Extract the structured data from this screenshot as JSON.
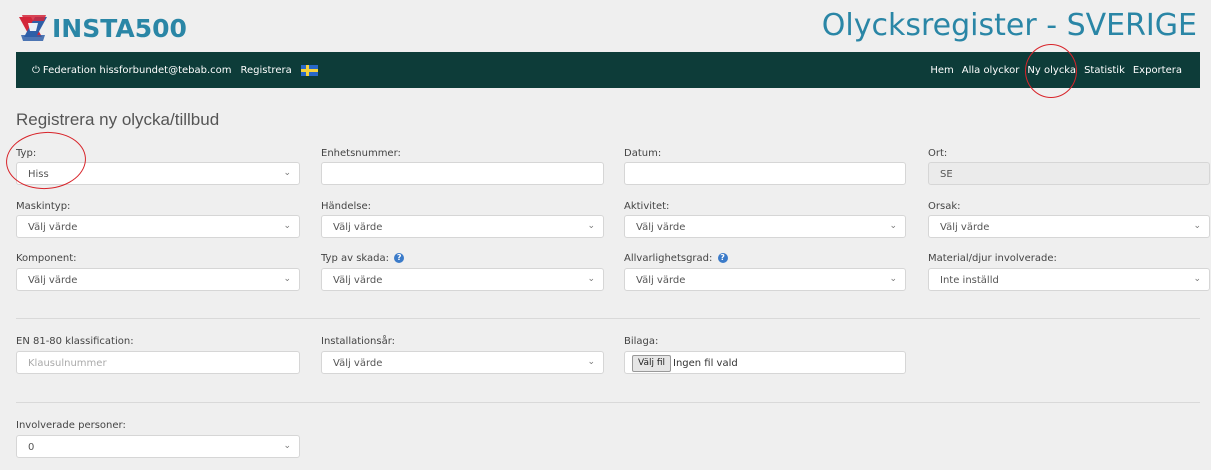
{
  "brand": {
    "logo_text": "INSTA500"
  },
  "app_title": "Olycksregister - SVERIGE",
  "nav": {
    "user": "Federation hissforbundet@tebab.com",
    "register_link": "Registrera",
    "links": [
      "Hem",
      "Alla olyckor",
      "Ny olycka",
      "Statistik",
      "Exportera"
    ]
  },
  "page_title": "Registrera ny olycka/tillbud",
  "form": {
    "typ": {
      "label": "Typ:",
      "value": "Hiss"
    },
    "enhetsnummer": {
      "label": "Enhetsnummer:",
      "value": ""
    },
    "datum": {
      "label": "Datum:",
      "value": ""
    },
    "ort": {
      "label": "Ort:",
      "value": "SE"
    },
    "maskintyp": {
      "label": "Maskintyp:",
      "value": "Välj värde"
    },
    "handelse": {
      "label": "Händelse:",
      "value": "Välj värde"
    },
    "aktivitet": {
      "label": "Aktivitet:",
      "value": "Välj värde"
    },
    "orsak": {
      "label": "Orsak:",
      "value": "Välj värde"
    },
    "komponent": {
      "label": "Komponent:",
      "value": "Välj värde"
    },
    "typ_av_skada": {
      "label": "Typ av skada:",
      "value": "Välj värde"
    },
    "allvarlighetsgrad": {
      "label": "Allvarlighetsgrad:",
      "value": "Välj värde"
    },
    "material": {
      "label": "Material/djur involverade:",
      "value": "Inte inställd"
    },
    "en8180": {
      "label": "EN 81-80 klassification:",
      "placeholder": "Klausulnummer"
    },
    "installationsar": {
      "label": "Installationsår:",
      "value": "Välj värde"
    },
    "bilaga": {
      "label": "Bilaga:",
      "button": "Välj fil",
      "status": "Ingen fil vald"
    },
    "involverade": {
      "label": "Involverade personer:",
      "value": "0"
    }
  },
  "icons": {
    "power": "power-icon",
    "flag": "swedish-flag-icon",
    "help": "help-icon",
    "chevron": "chevron-down-icon"
  },
  "colors": {
    "navbar": "#0d3c39",
    "brand": "#2a86a6",
    "annotation": "#d8242a",
    "help": "#3b7bc9"
  }
}
